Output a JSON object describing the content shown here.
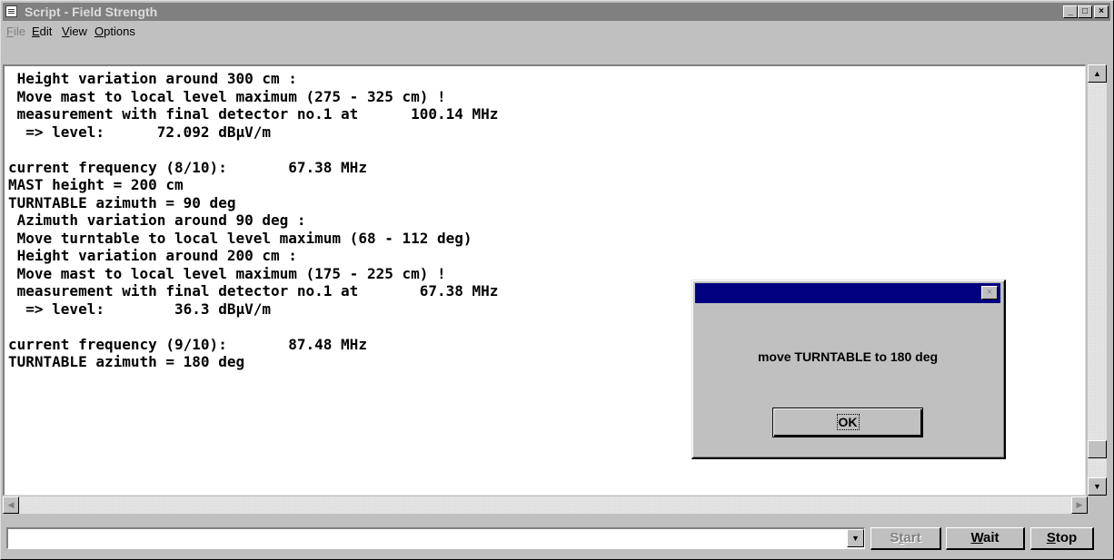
{
  "window": {
    "title": "Script - Field Strength",
    "icon": "document-icon",
    "controls": {
      "minimize": "_",
      "maximize": "□",
      "close": "×"
    }
  },
  "menu": {
    "items": [
      {
        "label": "File",
        "enabled": false
      },
      {
        "label": "Edit",
        "enabled": true
      },
      {
        "label": "View",
        "enabled": true
      },
      {
        "label": "Options",
        "enabled": true
      }
    ]
  },
  "log": {
    "lines": [
      " Height variation around 300 cm :",
      " Move mast to local level maximum (275 - 325 cm) !",
      " measurement with final detector no.1 at      100.14 MHz",
      "  => level:      72.092 dBµV/m",
      "",
      "current frequency (8/10):       67.38 MHz",
      "MAST height = 200 cm",
      "TURNTABLE azimuth = 90 deg",
      " Azimuth variation around 90 deg :",
      " Move turntable to local level maximum (68 - 112 deg)",
      " Height variation around 200 cm :",
      " Move mast to local level maximum (175 - 225 cm) !",
      " measurement with final detector no.1 at       67.38 MHz",
      "  => level:        36.3 dBµV/m",
      "",
      "current frequency (9/10):       87.48 MHz",
      "TURNTABLE azimuth = 180 deg"
    ]
  },
  "scrollbar": {
    "up": "▲",
    "down": "▼",
    "left": "◀",
    "right": "▶"
  },
  "command_bar": {
    "input_value": "",
    "dropdown": "▼",
    "start_label": "Start",
    "wait_label": "Wait",
    "stop_label": "Stop"
  },
  "dialog": {
    "title": "",
    "close": "×",
    "message": "move TURNTABLE to 180 deg",
    "ok_label": "OK"
  }
}
